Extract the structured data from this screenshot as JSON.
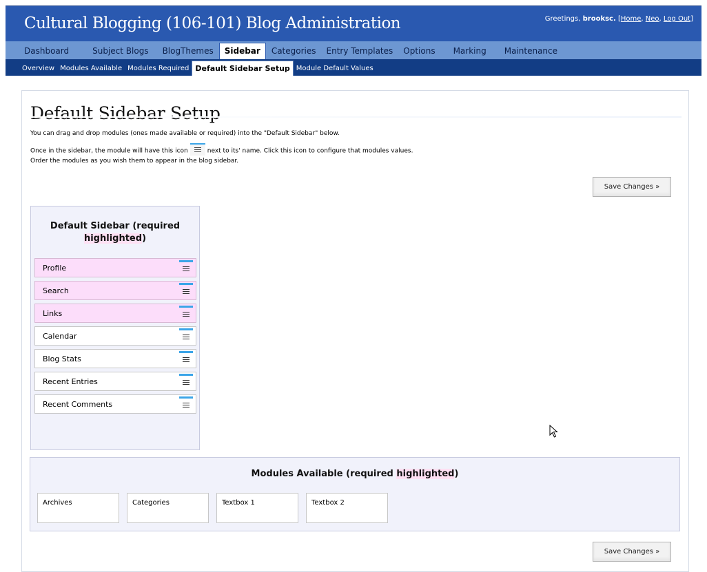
{
  "header": {
    "title": "Cultural Blogging (106-101) Blog Administration",
    "greeting_prefix": "Greetings,",
    "username": "brooksc.",
    "link_open": "[",
    "home_link": "Home",
    "sep1": ",",
    "neo_link": "Neo",
    "sep2": ",",
    "logout_link": "Log Out",
    "link_close": "]"
  },
  "nav_primary": [
    {
      "label": "Dashboard"
    },
    {
      "label": "Subject Blogs"
    },
    {
      "label": "BlogThemes"
    },
    {
      "label": "Sidebar",
      "active": true
    },
    {
      "label": "Categories"
    },
    {
      "label": "Entry Templates"
    },
    {
      "label": "Options"
    },
    {
      "label": "Marking"
    },
    {
      "label": "Maintenance"
    }
  ],
  "nav_secondary": [
    {
      "label": "Overview"
    },
    {
      "label": "Modules Available"
    },
    {
      "label": "Modules Required"
    },
    {
      "label": "Default Sidebar Setup",
      "active": true
    },
    {
      "label": "Module Default Values"
    }
  ],
  "page": {
    "title": "Default Sidebar Setup",
    "line1": "You can drag and drop modules (ones made available or required) into the \"Default Sidebar\" below.",
    "line2_a": "Once in the sidebar, the module will have this icon",
    "line2_b": "next to its' name. Click this icon to configure that modules values.",
    "line3": "Order the modules as you wish them to appear in the blog sidebar.",
    "save_label": "Save Changes »"
  },
  "sidebar": {
    "title_part1": "Default Sidebar (required",
    "title_part2": "highlighted",
    "title_part3": ")",
    "modules": [
      {
        "label": "Profile",
        "required": true
      },
      {
        "label": "Search",
        "required": true
      },
      {
        "label": "Links",
        "required": true
      },
      {
        "label": "Calendar",
        "required": false
      },
      {
        "label": "Blog Stats",
        "required": false
      },
      {
        "label": "Recent Entries",
        "required": false
      },
      {
        "label": "Recent Comments",
        "required": false
      }
    ]
  },
  "available": {
    "title_part1": "Modules Available (required ",
    "title_part2": "highlighted",
    "title_part3": ")",
    "modules": [
      {
        "label": "Archives"
      },
      {
        "label": "Categories"
      },
      {
        "label": "Textbox 1"
      },
      {
        "label": "Textbox 2"
      }
    ]
  },
  "colors": {
    "header_bg": "#2a59b0",
    "nav_primary_bg": "#6d97d2",
    "nav_secondary_bg": "#123d85",
    "required_bg": "#fcddfa",
    "panel_bg": "#f1f2fb"
  },
  "icons": {
    "config": "list-config-icon",
    "cursor": "mouse-pointer-icon"
  }
}
